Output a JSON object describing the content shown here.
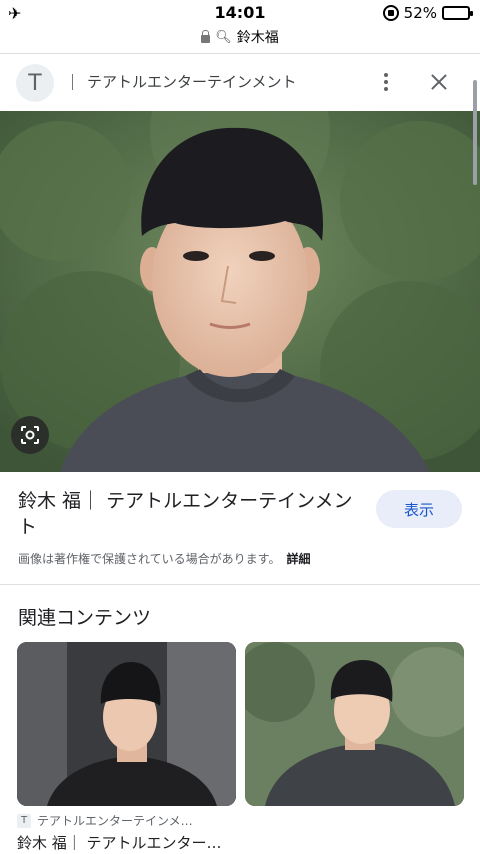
{
  "status_bar": {
    "time": "14:01",
    "battery": "52%",
    "airplane_icon": "airplane-icon"
  },
  "url_bar": {
    "url": "鈴木福"
  },
  "header": {
    "favicon_letter": "T",
    "source_title": "テアトルエンターテインメント"
  },
  "main": {
    "title": "鈴木 福｜ テアトルエンターテインメント",
    "show_button": "表示",
    "copyright_note": "画像は著作権で保護されている場合があります。",
    "details_link": "詳細"
  },
  "related": {
    "heading": "関連コンテンツ",
    "cards": [
      {
        "source_letter": "T",
        "source": "テアトルエンターテインメ…",
        "title": "鈴木 福｜ テアトルエンター…"
      },
      {
        "source_letter": "",
        "source": "",
        "title": ""
      }
    ]
  }
}
